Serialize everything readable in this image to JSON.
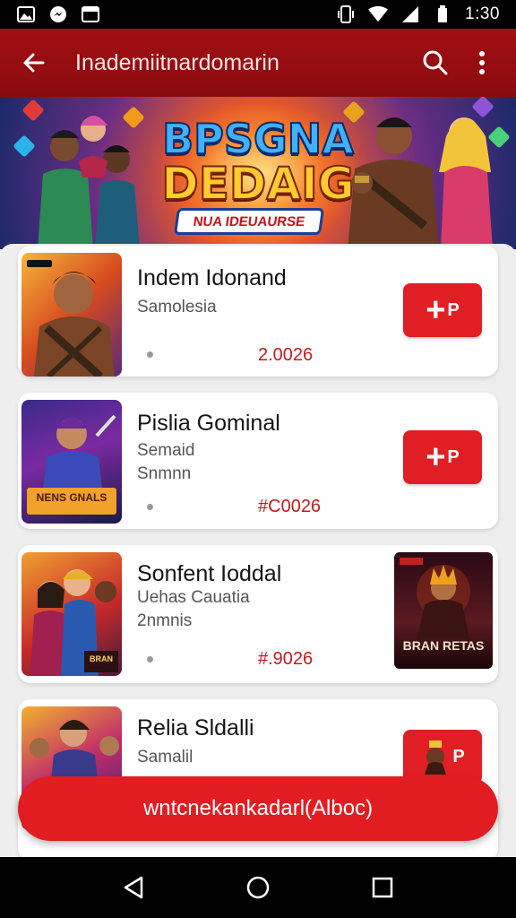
{
  "status_bar": {
    "time": "1:30"
  },
  "app_bar": {
    "title": "Inademiitnardomarin"
  },
  "hero": {
    "title_line1": "BPSGNA",
    "title_line2": "DEDAIG",
    "subtitle": "NUA IDEUAURSE"
  },
  "cards": [
    {
      "title": "Indem Idonand",
      "subtitle": "Samolesia",
      "subtitle2": "",
      "price": "2.0026",
      "action_label": "P"
    },
    {
      "title": "Pislia Gominal",
      "subtitle": "Semaid",
      "subtitle2": "Snmnn",
      "price": "#C0026",
      "action_label": "P"
    },
    {
      "title": "Sonfent Ioddal",
      "subtitle": "Uehas Cauatia",
      "subtitle2": "2nmnis",
      "price": "#.9026",
      "side_image_label": "BRAN RETAS"
    },
    {
      "title": "Relia Sldalli",
      "subtitle": "Samalil",
      "subtitle2": "",
      "action_label": "P"
    }
  ],
  "thumb_labels": {
    "card2": "NENS GNALS",
    "card3": "BRAN"
  },
  "cta": {
    "label": "wntcnekankadarl(Alboc)"
  },
  "colors": {
    "accent": "#e21e25",
    "app_bar": "#9b0e12",
    "price": "#c21a1f"
  }
}
